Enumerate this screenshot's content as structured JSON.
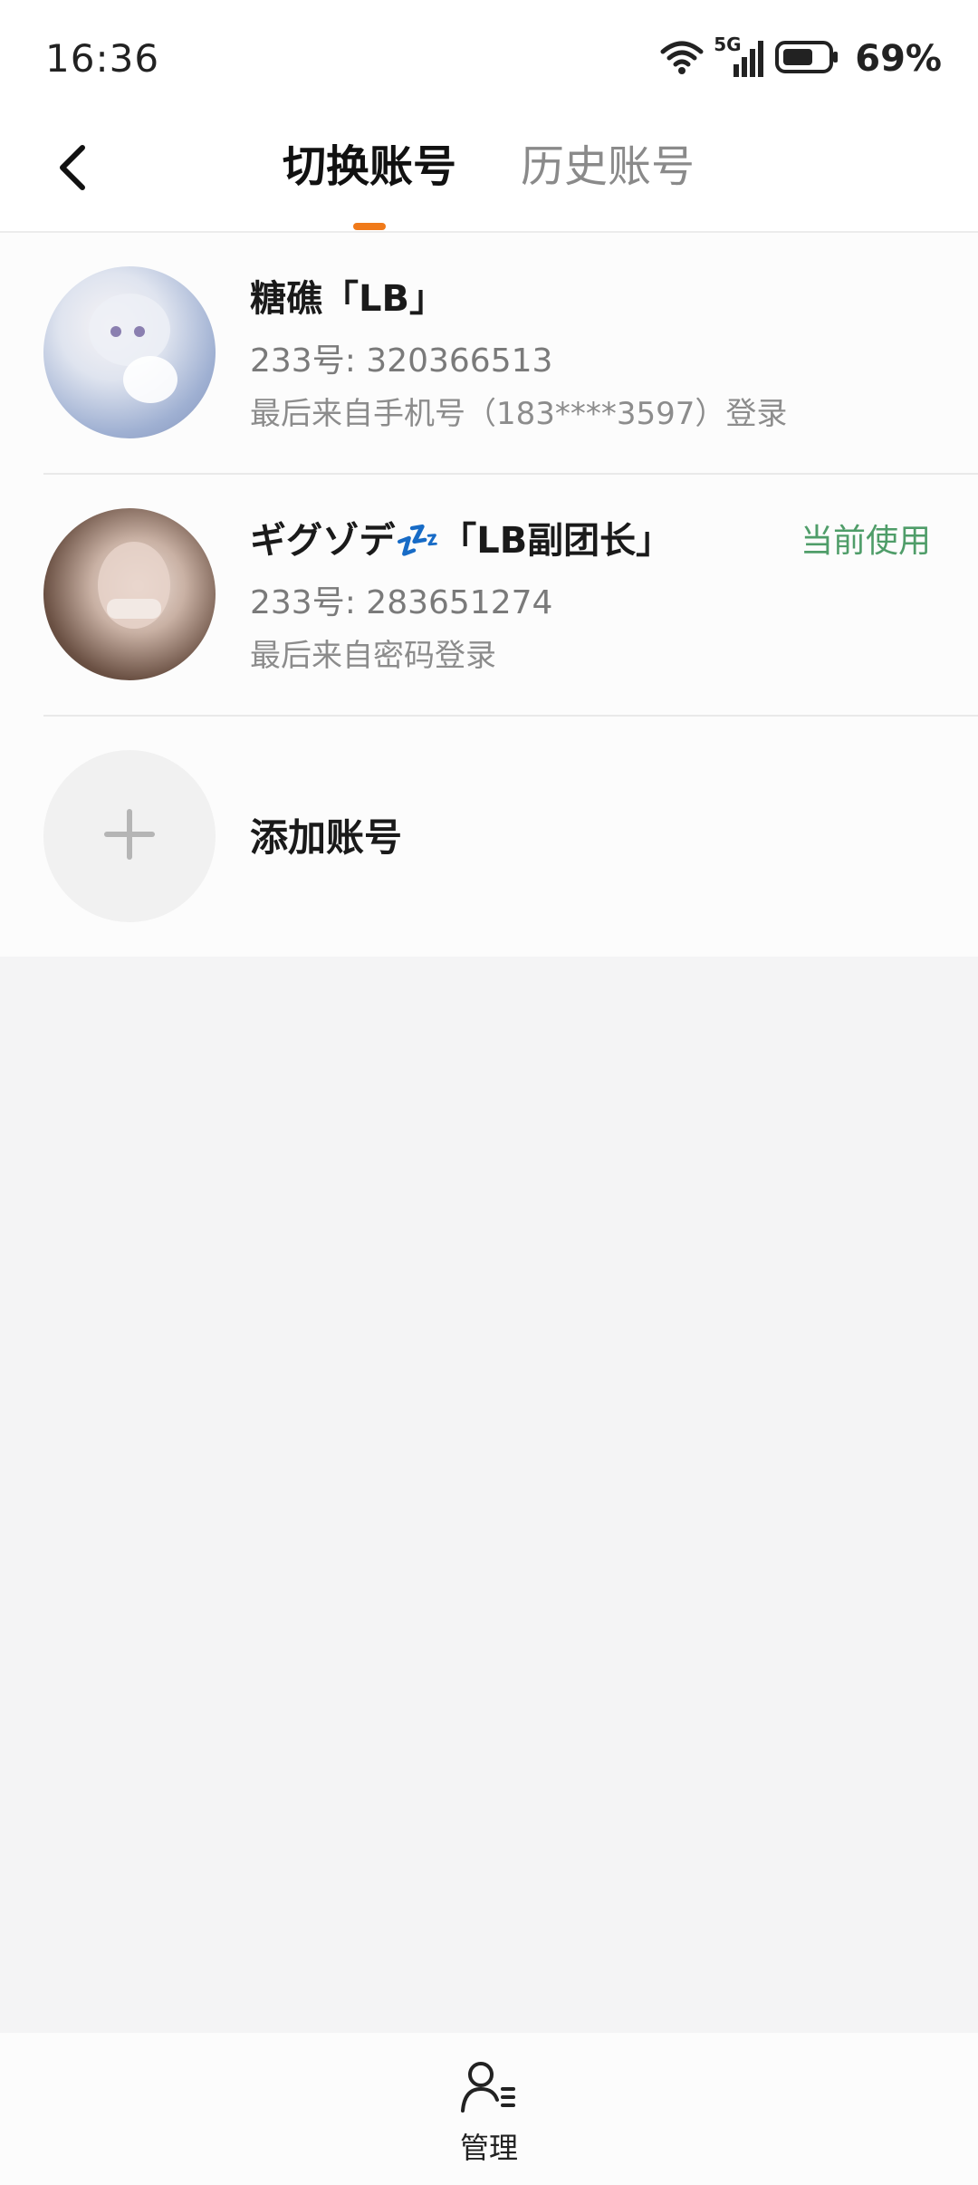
{
  "status_bar": {
    "time": "16:36",
    "network": "5G",
    "battery": "69%"
  },
  "header": {
    "tabs": [
      "切换账号",
      "历史账号"
    ],
    "active_tab_index": 0
  },
  "accounts": [
    {
      "name": "糖礁「LB」",
      "id": "233号: 320366513",
      "last_login": "最后来自手机号（183****3597）登录",
      "current_label": ""
    },
    {
      "name": "ギグゾデ💤「LB副团长」",
      "id": "233号: 283651274",
      "last_login": "最后来自密码登录",
      "current_label": "当前使用"
    }
  ],
  "add_account": {
    "label": "添加账号"
  },
  "bottom_bar": {
    "manage_label": "管理"
  },
  "colors": {
    "accent": "#f07a1a",
    "current": "#4f9d69"
  },
  "icons": {
    "back": "back-arrow-icon",
    "wifi": "wifi-icon",
    "signal": "signal-icon",
    "battery": "battery-icon",
    "add": "plus-icon",
    "manage": "user-manage-icon"
  }
}
